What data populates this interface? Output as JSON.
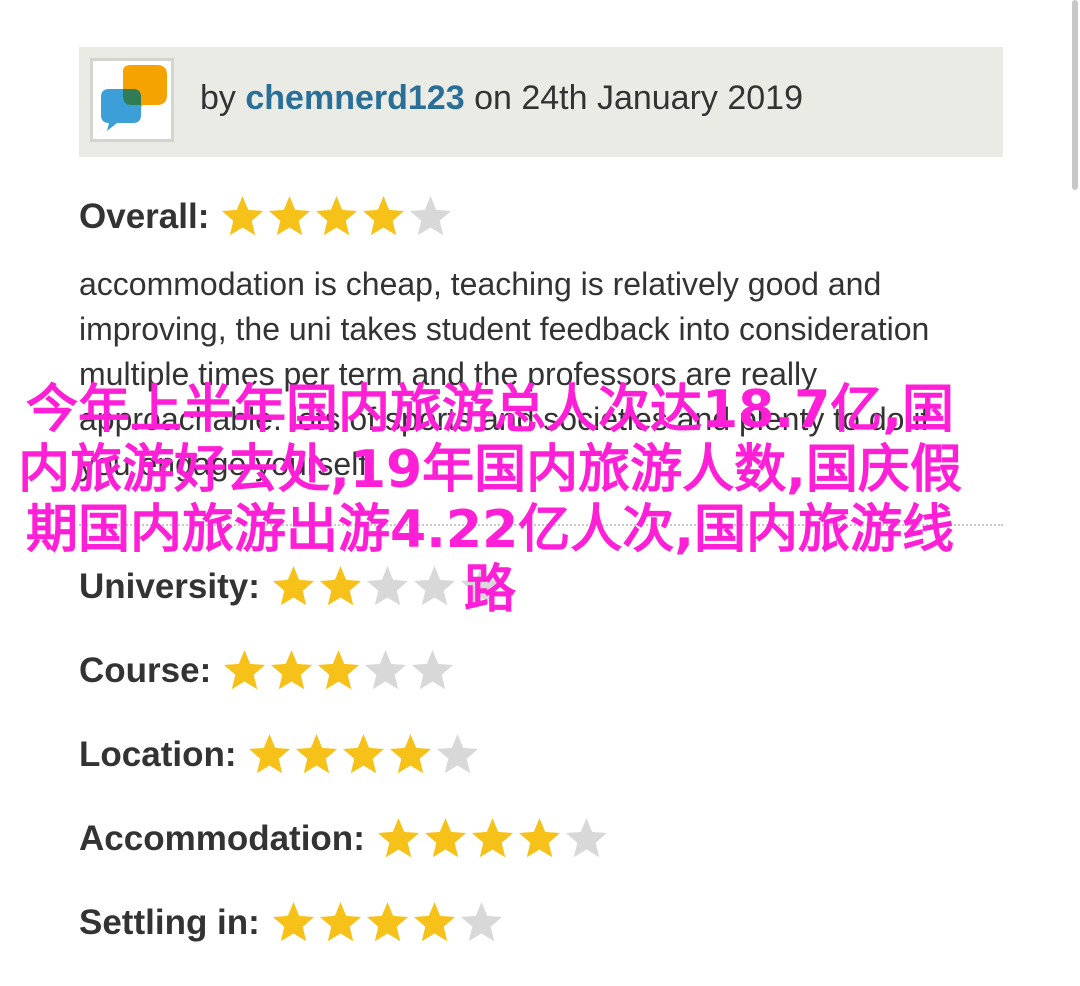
{
  "review": {
    "author_prefix": "by",
    "author": "chemnerd123",
    "date_text": "on 24th January 2019",
    "overall": {
      "label": "Overall:",
      "rating": 4,
      "max": 5
    },
    "text": "accommodation is cheap, teaching is relatively good and improving, the uni takes student feedback into consideration multiple times per term and the professors are really approachable. lots of sports and societies and plenty to do if you engage yourself"
  },
  "ratings": [
    {
      "label": "University:",
      "rating": 2,
      "max": 5
    },
    {
      "label": "Course:",
      "rating": 3,
      "max": 5
    },
    {
      "label": "Location:",
      "rating": 4,
      "max": 5
    },
    {
      "label": "Accommodation:",
      "rating": 4,
      "max": 5
    },
    {
      "label": "Settling in:",
      "rating": 4,
      "max": 5
    }
  ],
  "overlay_text": "今年上半年国内旅游总人次达18.7亿,国内旅游好去处,19年国内旅游人数,国庆假期国内旅游出游4.22亿人次,国内旅游线路",
  "colors": {
    "star_filled": "#f6c119",
    "star_empty": "#d8d8d8",
    "author_link": "#2a6f97",
    "overlay": "#ff1fd6",
    "author_bar_bg": "#ebebe6"
  },
  "icons": {
    "avatar": "speech-bubbles-icon",
    "star": "star-icon"
  }
}
